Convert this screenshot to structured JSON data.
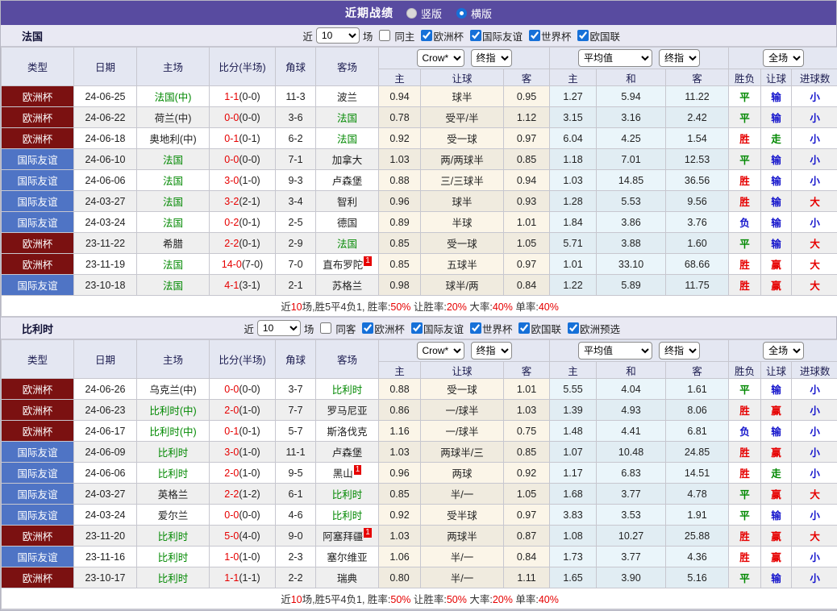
{
  "colors": {
    "accent_purple": "#584ba0",
    "type_colors": {
      "欧洲杯": "#7b1111",
      "国际友谊": "#4f74c5"
    },
    "team_green": "#008800",
    "score_red": "#e60000",
    "summary_red": "#e60000",
    "result_colors": {
      "胜": "#e60000",
      "平": "#008800",
      "负": "#1515cc",
      "赢": "#e60000",
      "输": "#1515cc",
      "走": "#008800",
      "大": "#e60000",
      "小": "#1515cc"
    }
  },
  "title_bar": {
    "title": "近期战绩",
    "radios": [
      {
        "label": "竖版",
        "selected": false
      },
      {
        "label": "横版",
        "selected": true
      }
    ]
  },
  "header": {
    "static_cols": [
      "类型",
      "日期",
      "主场",
      "比分(半场)",
      "角球",
      "客场"
    ],
    "groups": [
      {
        "selects": [
          "Crow*",
          "终指"
        ],
        "sub": [
          "主",
          "让球",
          "客"
        ]
      },
      {
        "selects": [
          "平均值",
          "终指"
        ],
        "sub": [
          "主",
          "和",
          "客"
        ]
      },
      {
        "selects": [
          "全场"
        ],
        "sub": [
          "胜负",
          "让球",
          "进球数"
        ]
      }
    ]
  },
  "sections": [
    {
      "team": "法国",
      "filter": {
        "near": "近",
        "count": "10",
        "games": "场",
        "same_label": "同主",
        "same_checked": false,
        "competitions": [
          "欧洲杯",
          "国际友谊",
          "世界杯",
          "欧国联"
        ]
      },
      "rows": [
        {
          "type": "欧洲杯",
          "date": "24-06-25",
          "home": "法国(中)",
          "home_green": true,
          "score": "1-1",
          "half": "(0-0)",
          "corners": "11-3",
          "away": "波兰",
          "away_green": false,
          "away_badge": "",
          "odds": [
            "0.94",
            "球半",
            "0.95"
          ],
          "avg": [
            "1.27",
            "5.94",
            "11.22"
          ],
          "results": [
            "平",
            "输",
            "小"
          ]
        },
        {
          "type": "欧洲杯",
          "date": "24-06-22",
          "home": "荷兰(中)",
          "home_green": false,
          "score": "0-0",
          "half": "(0-0)",
          "corners": "3-6",
          "away": "法国",
          "away_green": true,
          "away_badge": "",
          "odds": [
            "0.78",
            "受平/半",
            "1.12"
          ],
          "avg": [
            "3.15",
            "3.16",
            "2.42"
          ],
          "results": [
            "平",
            "输",
            "小"
          ]
        },
        {
          "type": "欧洲杯",
          "date": "24-06-18",
          "home": "奥地利(中)",
          "home_green": false,
          "score": "0-1",
          "half": "(0-1)",
          "corners": "6-2",
          "away": "法国",
          "away_green": true,
          "away_badge": "",
          "odds": [
            "0.92",
            "受一球",
            "0.97"
          ],
          "avg": [
            "6.04",
            "4.25",
            "1.54"
          ],
          "results": [
            "胜",
            "走",
            "小"
          ]
        },
        {
          "type": "国际友谊",
          "date": "24-06-10",
          "home": "法国",
          "home_green": true,
          "score": "0-0",
          "half": "(0-0)",
          "corners": "7-1",
          "away": "加拿大",
          "away_green": false,
          "away_badge": "",
          "odds": [
            "1.03",
            "两/两球半",
            "0.85"
          ],
          "avg": [
            "1.18",
            "7.01",
            "12.53"
          ],
          "results": [
            "平",
            "输",
            "小"
          ]
        },
        {
          "type": "国际友谊",
          "date": "24-06-06",
          "home": "法国",
          "home_green": true,
          "score": "3-0",
          "half": "(1-0)",
          "corners": "9-3",
          "away": "卢森堡",
          "away_green": false,
          "away_badge": "",
          "odds": [
            "0.88",
            "三/三球半",
            "0.94"
          ],
          "avg": [
            "1.03",
            "14.85",
            "36.56"
          ],
          "results": [
            "胜",
            "输",
            "小"
          ]
        },
        {
          "type": "国际友谊",
          "date": "24-03-27",
          "home": "法国",
          "home_green": true,
          "score": "3-2",
          "half": "(2-1)",
          "corners": "3-4",
          "away": "智利",
          "away_green": false,
          "away_badge": "",
          "odds": [
            "0.96",
            "球半",
            "0.93"
          ],
          "avg": [
            "1.28",
            "5.53",
            "9.56"
          ],
          "results": [
            "胜",
            "输",
            "大"
          ]
        },
        {
          "type": "国际友谊",
          "date": "24-03-24",
          "home": "法国",
          "home_green": true,
          "score": "0-2",
          "half": "(0-1)",
          "corners": "2-5",
          "away": "德国",
          "away_green": false,
          "away_badge": "",
          "odds": [
            "0.89",
            "半球",
            "1.01"
          ],
          "avg": [
            "1.84",
            "3.86",
            "3.76"
          ],
          "results": [
            "负",
            "输",
            "小"
          ]
        },
        {
          "type": "欧洲杯",
          "date": "23-11-22",
          "home": "希腊",
          "home_green": false,
          "score": "2-2",
          "half": "(0-1)",
          "corners": "2-9",
          "away": "法国",
          "away_green": true,
          "away_badge": "",
          "odds": [
            "0.85",
            "受一球",
            "1.05"
          ],
          "avg": [
            "5.71",
            "3.88",
            "1.60"
          ],
          "results": [
            "平",
            "输",
            "大"
          ]
        },
        {
          "type": "欧洲杯",
          "date": "23-11-19",
          "home": "法国",
          "home_green": true,
          "score": "14-0",
          "half": "(7-0)",
          "corners": "7-0",
          "away": "直布罗陀",
          "away_green": false,
          "away_badge": "1",
          "odds": [
            "0.85",
            "五球半",
            "0.97"
          ],
          "avg": [
            "1.01",
            "33.10",
            "68.66"
          ],
          "results": [
            "胜",
            "赢",
            "大"
          ]
        },
        {
          "type": "国际友谊",
          "date": "23-10-18",
          "home": "法国",
          "home_green": true,
          "score": "4-1",
          "half": "(3-1)",
          "corners": "2-1",
          "away": "苏格兰",
          "away_green": false,
          "away_badge": "",
          "odds": [
            "0.98",
            "球半/两",
            "0.84"
          ],
          "avg": [
            "1.22",
            "5.89",
            "11.75"
          ],
          "results": [
            "胜",
            "赢",
            "大"
          ]
        }
      ],
      "summary": [
        {
          "text": "近"
        },
        {
          "text": "10",
          "red": true
        },
        {
          "text": "场,胜5平4负1, 胜率:"
        },
        {
          "text": "50%",
          "red": true
        },
        {
          "text": " 让胜率:"
        },
        {
          "text": "20%",
          "red": true
        },
        {
          "text": " 大率:"
        },
        {
          "text": "40%",
          "red": true
        },
        {
          "text": " 单率:"
        },
        {
          "text": "40%",
          "red": true
        }
      ]
    },
    {
      "team": "比利时",
      "filter": {
        "near": "近",
        "count": "10",
        "games": "场",
        "same_label": "同客",
        "same_checked": false,
        "competitions": [
          "欧洲杯",
          "国际友谊",
          "世界杯",
          "欧国联",
          "欧洲预选"
        ]
      },
      "rows": [
        {
          "type": "欧洲杯",
          "date": "24-06-26",
          "home": "乌克兰(中)",
          "home_green": false,
          "score": "0-0",
          "half": "(0-0)",
          "corners": "3-7",
          "away": "比利时",
          "away_green": true,
          "away_badge": "",
          "odds": [
            "0.88",
            "受一球",
            "1.01"
          ],
          "avg": [
            "5.55",
            "4.04",
            "1.61"
          ],
          "results": [
            "平",
            "输",
            "小"
          ]
        },
        {
          "type": "欧洲杯",
          "date": "24-06-23",
          "home": "比利时(中)",
          "home_green": true,
          "score": "2-0",
          "half": "(1-0)",
          "corners": "7-7",
          "away": "罗马尼亚",
          "away_green": false,
          "away_badge": "",
          "odds": [
            "0.86",
            "一/球半",
            "1.03"
          ],
          "avg": [
            "1.39",
            "4.93",
            "8.06"
          ],
          "results": [
            "胜",
            "赢",
            "小"
          ]
        },
        {
          "type": "欧洲杯",
          "date": "24-06-17",
          "home": "比利时(中)",
          "home_green": true,
          "score": "0-1",
          "half": "(0-1)",
          "corners": "5-7",
          "away": "斯洛伐克",
          "away_green": false,
          "away_badge": "",
          "odds": [
            "1.16",
            "一/球半",
            "0.75"
          ],
          "avg": [
            "1.48",
            "4.41",
            "6.81"
          ],
          "results": [
            "负",
            "输",
            "小"
          ]
        },
        {
          "type": "国际友谊",
          "date": "24-06-09",
          "home": "比利时",
          "home_green": true,
          "score": "3-0",
          "half": "(1-0)",
          "corners": "11-1",
          "away": "卢森堡",
          "away_green": false,
          "away_badge": "",
          "odds": [
            "1.03",
            "两球半/三",
            "0.85"
          ],
          "avg": [
            "1.07",
            "10.48",
            "24.85"
          ],
          "results": [
            "胜",
            "赢",
            "小"
          ]
        },
        {
          "type": "国际友谊",
          "date": "24-06-06",
          "home": "比利时",
          "home_green": true,
          "score": "2-0",
          "half": "(1-0)",
          "corners": "9-5",
          "away": "黑山",
          "away_green": false,
          "away_badge": "1",
          "odds": [
            "0.96",
            "两球",
            "0.92"
          ],
          "avg": [
            "1.17",
            "6.83",
            "14.51"
          ],
          "results": [
            "胜",
            "走",
            "小"
          ]
        },
        {
          "type": "国际友谊",
          "date": "24-03-27",
          "home": "英格兰",
          "home_green": false,
          "score": "2-2",
          "half": "(1-2)",
          "corners": "6-1",
          "away": "比利时",
          "away_green": true,
          "away_badge": "",
          "odds": [
            "0.85",
            "半/一",
            "1.05"
          ],
          "avg": [
            "1.68",
            "3.77",
            "4.78"
          ],
          "results": [
            "平",
            "赢",
            "大"
          ]
        },
        {
          "type": "国际友谊",
          "date": "24-03-24",
          "home": "爱尔兰",
          "home_green": false,
          "score": "0-0",
          "half": "(0-0)",
          "corners": "4-6",
          "away": "比利时",
          "away_green": true,
          "away_badge": "",
          "odds": [
            "0.92",
            "受半球",
            "0.97"
          ],
          "avg": [
            "3.83",
            "3.53",
            "1.91"
          ],
          "results": [
            "平",
            "输",
            "小"
          ]
        },
        {
          "type": "欧洲杯",
          "date": "23-11-20",
          "home": "比利时",
          "home_green": true,
          "score": "5-0",
          "half": "(4-0)",
          "corners": "9-0",
          "away": "阿塞拜疆",
          "away_green": false,
          "away_badge": "1",
          "odds": [
            "1.03",
            "两球半",
            "0.87"
          ],
          "avg": [
            "1.08",
            "10.27",
            "25.88"
          ],
          "results": [
            "胜",
            "赢",
            "大"
          ]
        },
        {
          "type": "国际友谊",
          "date": "23-11-16",
          "home": "比利时",
          "home_green": true,
          "score": "1-0",
          "half": "(1-0)",
          "corners": "2-3",
          "away": "塞尔维亚",
          "away_green": false,
          "away_badge": "",
          "odds": [
            "1.06",
            "半/一",
            "0.84"
          ],
          "avg": [
            "1.73",
            "3.77",
            "4.36"
          ],
          "results": [
            "胜",
            "赢",
            "小"
          ]
        },
        {
          "type": "欧洲杯",
          "date": "23-10-17",
          "home": "比利时",
          "home_green": true,
          "score": "1-1",
          "half": "(1-1)",
          "corners": "2-2",
          "away": "瑞典",
          "away_green": false,
          "away_badge": "",
          "odds": [
            "0.80",
            "半/一",
            "1.11"
          ],
          "avg": [
            "1.65",
            "3.90",
            "5.16"
          ],
          "results": [
            "平",
            "输",
            "小"
          ]
        }
      ],
      "summary": [
        {
          "text": "近"
        },
        {
          "text": "10",
          "red": true
        },
        {
          "text": "场,胜5平4负1, 胜率:"
        },
        {
          "text": "50%",
          "red": true
        },
        {
          "text": " 让胜率:"
        },
        {
          "text": "50%",
          "red": true
        },
        {
          "text": " 大率:"
        },
        {
          "text": "20%",
          "red": true
        },
        {
          "text": " 单率:"
        },
        {
          "text": "40%",
          "red": true
        }
      ]
    }
  ]
}
